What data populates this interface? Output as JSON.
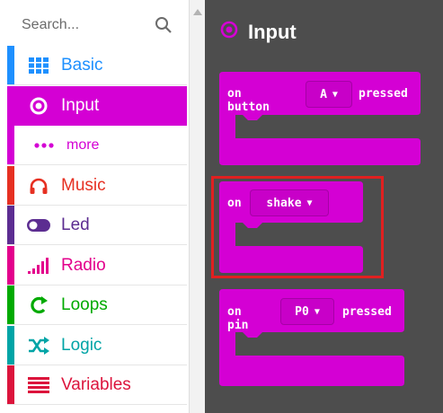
{
  "search": {
    "placeholder": "Search..."
  },
  "categories": [
    {
      "label": "Basic",
      "color": "#1e90ff",
      "icon": "grid-icon",
      "selected": false
    },
    {
      "label": "Input",
      "color": "#d400d4",
      "icon": "target-icon",
      "selected": true
    },
    {
      "label": "more",
      "color": "#d400d4",
      "icon": "more-dots-icon",
      "selected": false
    },
    {
      "label": "Music",
      "color": "#e63022",
      "icon": "headphones-icon",
      "selected": false
    },
    {
      "label": "Led",
      "color": "#5c2d91",
      "icon": "toggle-icon",
      "selected": false
    },
    {
      "label": "Radio",
      "color": "#e3008c",
      "icon": "signal-bars-icon",
      "selected": false
    },
    {
      "label": "Loops",
      "color": "#00aa00",
      "icon": "loop-arrow-icon",
      "selected": false
    },
    {
      "label": "Logic",
      "color": "#00a4a6",
      "icon": "shuffle-icon",
      "selected": false
    },
    {
      "label": "Variables",
      "color": "#dc143c",
      "icon": "list-lines-icon",
      "selected": false
    }
  ],
  "flyout": {
    "title": "Input",
    "blocks": [
      {
        "pre": "on button",
        "dropdown": "A",
        "post": "pressed"
      },
      {
        "pre": "on",
        "dropdown": "shake",
        "post": ""
      },
      {
        "pre": "on pin",
        "dropdown": "P0",
        "post": "pressed"
      }
    ]
  },
  "colors": {
    "block": "#d400d4",
    "flyout_bg": "#4d4d4d",
    "highlight": "#e02020"
  }
}
